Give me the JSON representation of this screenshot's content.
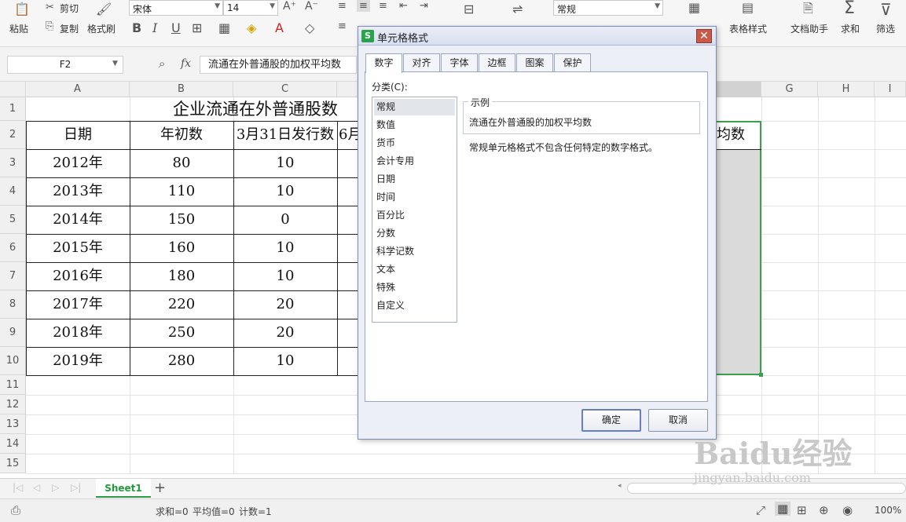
{
  "ribbon": {
    "paste": "粘贴",
    "cut": "剪切",
    "copy": "复制",
    "format_painter": "格式刷",
    "font_name": "宋体",
    "font_size": "14",
    "number_format": "常规",
    "table_style": "表格样式",
    "doc_assistant": "文档助手",
    "sum": "求和",
    "filter": "筛选"
  },
  "formula_bar": {
    "name_box": "F2",
    "fx": "fx",
    "content": "流通在外普通股的加权平均数"
  },
  "sheet": {
    "columns": [
      "A",
      "B",
      "C",
      "G",
      "H",
      "I"
    ],
    "rows": [
      "1",
      "2",
      "3",
      "4",
      "5",
      "6",
      "7",
      "8",
      "9",
      "10",
      "11",
      "12",
      "13",
      "14",
      "15"
    ],
    "title": "企业流通在外普通股数",
    "headers": [
      "日期",
      "年初数",
      "3月31日发行数",
      "6月",
      "均数"
    ],
    "data": [
      [
        "2012年",
        "80",
        "10"
      ],
      [
        "2013年",
        "110",
        "10"
      ],
      [
        "2014年",
        "150",
        "0"
      ],
      [
        "2015年",
        "160",
        "10"
      ],
      [
        "2016年",
        "180",
        "10"
      ],
      [
        "2017年",
        "220",
        "20"
      ],
      [
        "2018年",
        "250",
        "20"
      ],
      [
        "2019年",
        "280",
        "10"
      ]
    ],
    "tab": "Sheet1"
  },
  "status": {
    "sum": "求和=0",
    "avg": "平均值=0",
    "count": "计数=1",
    "zoom": "100%"
  },
  "dialog": {
    "title": "单元格格式",
    "tabs": [
      "数字",
      "对齐",
      "字体",
      "边框",
      "图案",
      "保护"
    ],
    "category_label": "分类(C):",
    "categories": [
      "常规",
      "数值",
      "货币",
      "会计专用",
      "日期",
      "时间",
      "百分比",
      "分数",
      "科学记数",
      "文本",
      "特殊",
      "自定义"
    ],
    "sample_label": "示例",
    "sample_value": "流通在外普通股的加权平均数",
    "description": "常规单元格格式不包含任何特定的数字格式。",
    "ok": "确定",
    "cancel": "取消"
  },
  "watermark": {
    "brand": "Baidu经验",
    "url": "jingyan.baidu.com"
  }
}
